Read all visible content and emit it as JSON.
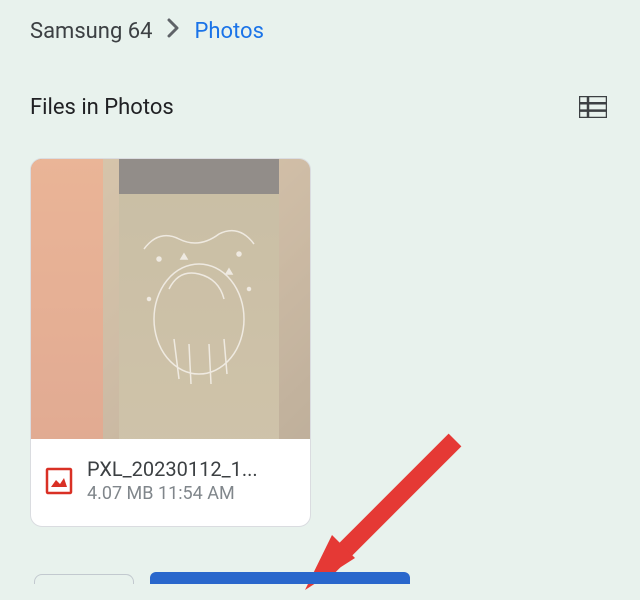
{
  "breadcrumb": {
    "parent": "Samsung 64",
    "current": "Photos"
  },
  "section": {
    "title": "Files in Photos"
  },
  "file": {
    "name": "PXL_20230112_1...",
    "size": "4.07 MB",
    "time": "11:54 AM"
  }
}
